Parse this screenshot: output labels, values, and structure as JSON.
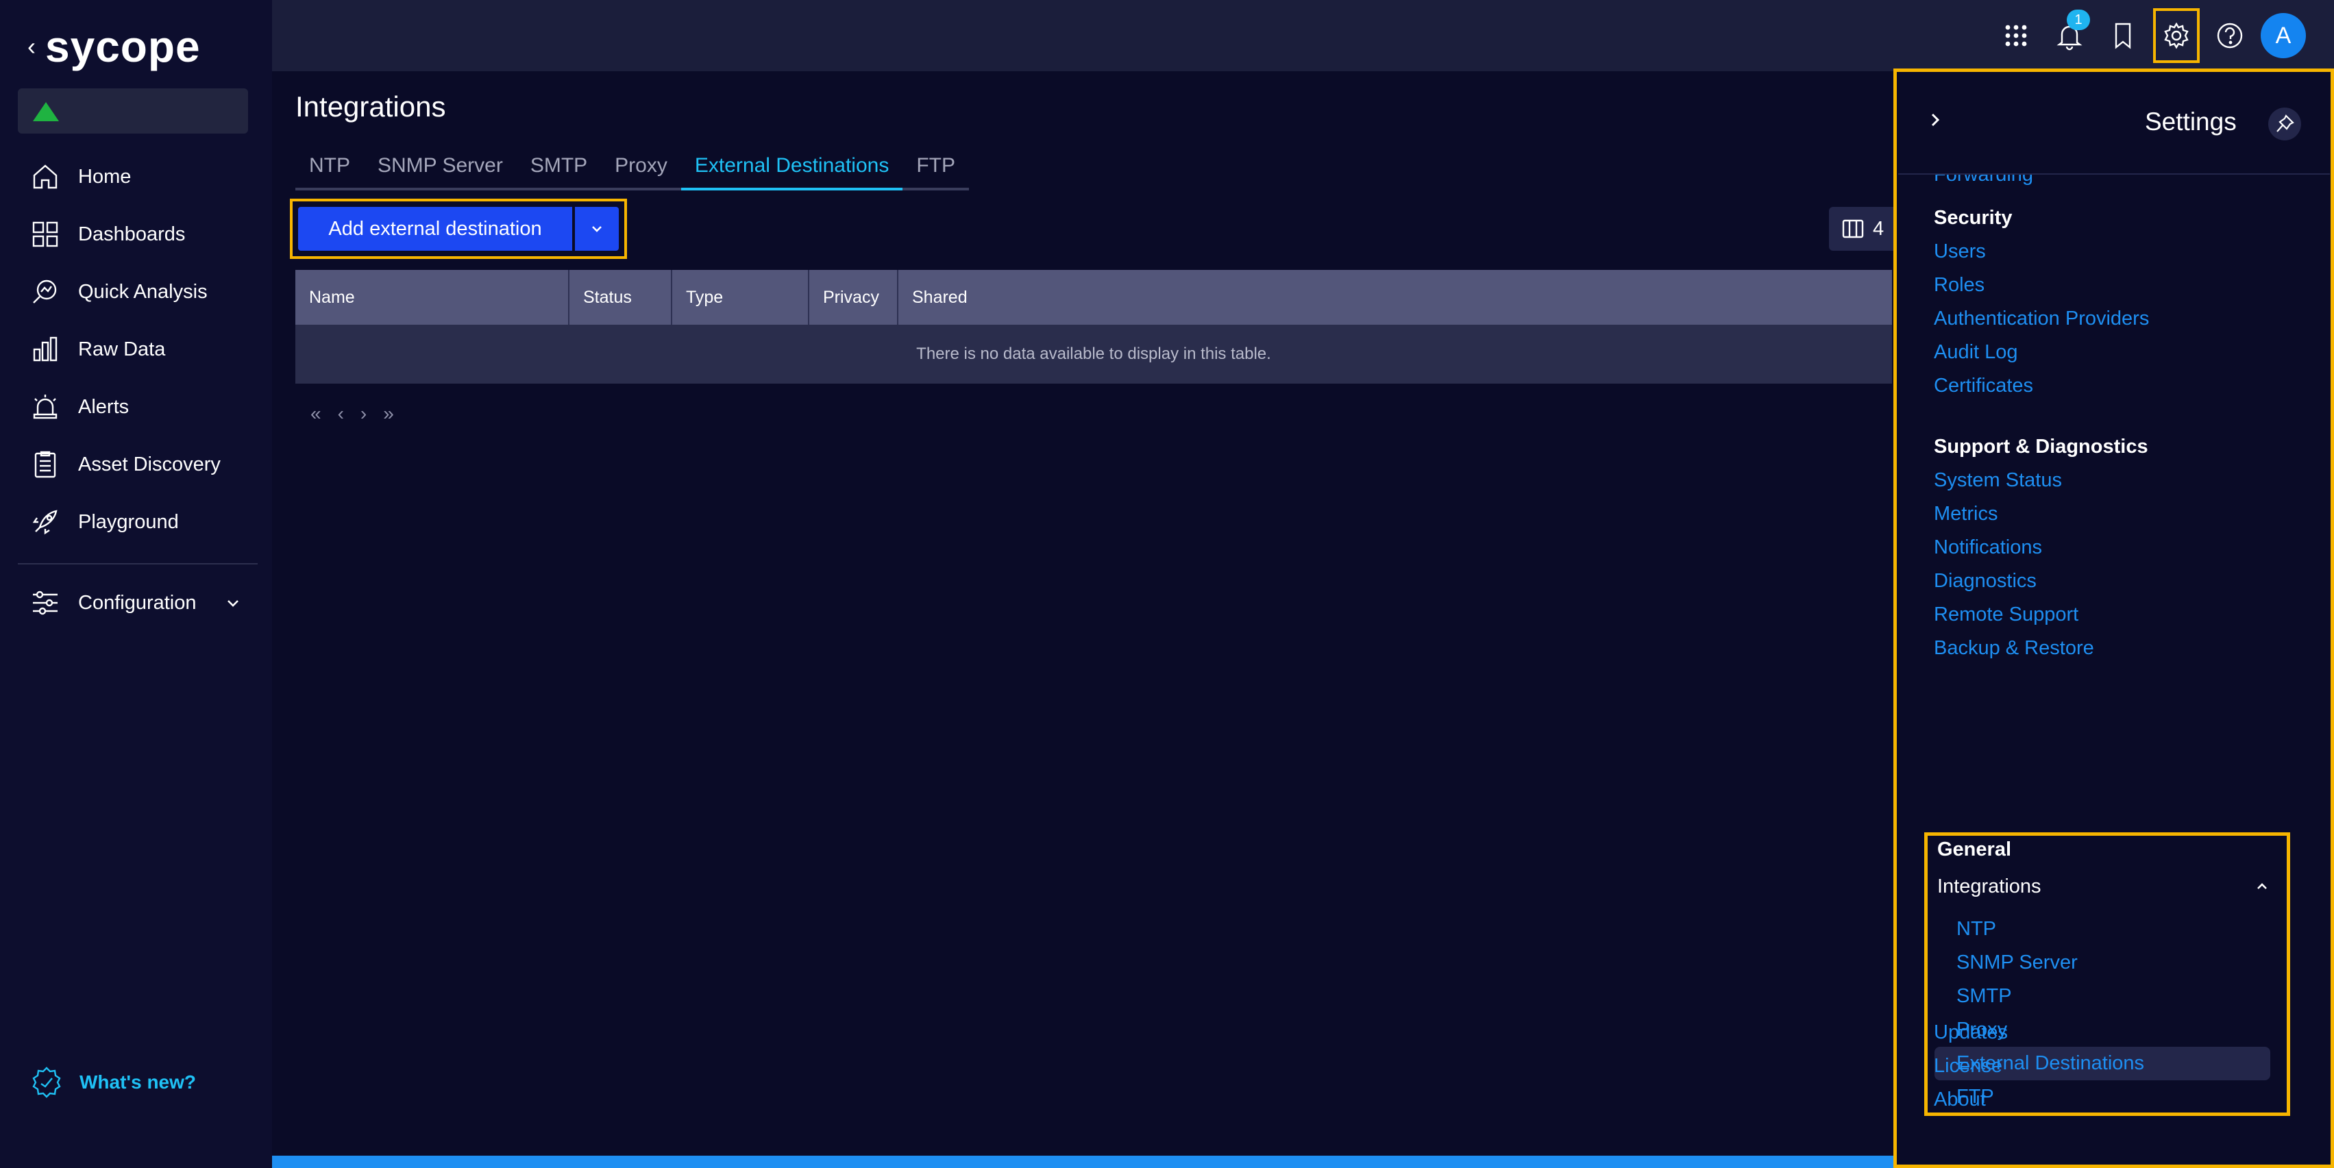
{
  "app": {
    "logo_text": "sycope",
    "back_glyph": "‹"
  },
  "sidebar": {
    "items": [
      {
        "label": "Home",
        "icon": "home-icon"
      },
      {
        "label": "Dashboards",
        "icon": "dashboards-icon"
      },
      {
        "label": "Quick Analysis",
        "icon": "quick-analysis-icon"
      },
      {
        "label": "Raw Data",
        "icon": "raw-data-icon"
      },
      {
        "label": "Alerts",
        "icon": "alerts-icon"
      },
      {
        "label": "Asset Discovery",
        "icon": "asset-discovery-icon"
      },
      {
        "label": "Playground",
        "icon": "playground-icon"
      }
    ],
    "configuration": {
      "label": "Configuration",
      "icon": "configuration-icon"
    },
    "whats_new": "What's new?",
    "status_color": "#1fb341"
  },
  "topbar": {
    "notification_count": "1",
    "avatar_letter": "A"
  },
  "page": {
    "title": "Integrations",
    "tabs": [
      "NTP",
      "SNMP Server",
      "SMTP",
      "Proxy",
      "External Destinations",
      "FTP"
    ],
    "active_tab": "External Destinations"
  },
  "toolbar": {
    "add_label": "Add external destination",
    "columns_count": "4"
  },
  "table": {
    "columns": [
      "Name",
      "Status",
      "Type",
      "Privacy",
      "Shared"
    ],
    "empty_message": "There is no data available to display in this table."
  },
  "pager": {
    "first": "«",
    "prev": "‹",
    "next": "›",
    "last": "»"
  },
  "settings": {
    "title": "Settings",
    "cut_off_link": "Forwarding",
    "security": {
      "heading": "Security",
      "links": [
        "Users",
        "Roles",
        "Authentication Providers",
        "Audit Log",
        "Certificates"
      ]
    },
    "support": {
      "heading": "Support & Diagnostics",
      "links": [
        "System Status",
        "Metrics",
        "Notifications",
        "Diagnostics",
        "Remote Support",
        "Backup & Restore"
      ]
    },
    "general": {
      "heading": "General",
      "integrations_label": "Integrations",
      "integrations_links": [
        "NTP",
        "SNMP Server",
        "SMTP",
        "Proxy",
        "External Destinations",
        "FTP"
      ],
      "active_link": "External Destinations",
      "other_links": [
        "Updates",
        "License",
        "About"
      ]
    }
  },
  "colors": {
    "accent": "#1fc1f5",
    "link": "#1e8ff2",
    "primary_button": "#1c48f2",
    "highlight": "#f7b500",
    "background": "#0a0b27"
  }
}
